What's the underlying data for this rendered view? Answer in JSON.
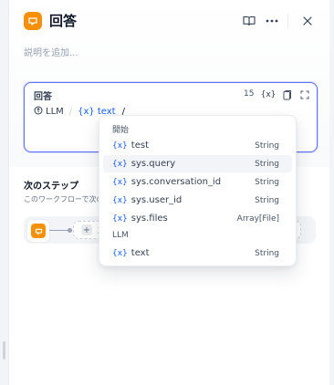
{
  "header": {
    "title": "回答",
    "description_placeholder": "説明を追加...",
    "icon_color": "#f79009"
  },
  "editor": {
    "label": "回答",
    "char_count": "15",
    "var_chip": {
      "node": "LLM",
      "var": "text"
    },
    "typed": "/"
  },
  "next_step": {
    "title": "次のステップ",
    "description": "このワークフローで次のブ",
    "add_label": "次の"
  },
  "dropdown": {
    "groups": [
      {
        "name": "開始",
        "items": [
          {
            "name": "test",
            "type": "String"
          },
          {
            "name": "sys.query",
            "type": "String",
            "active": true
          },
          {
            "name": "sys.conversation_id",
            "type": "String"
          },
          {
            "name": "sys.user_id",
            "type": "String"
          },
          {
            "name": "sys.files",
            "type": "Array[File]"
          }
        ]
      },
      {
        "name": "LLM",
        "items": [
          {
            "name": "text",
            "type": "String"
          }
        ]
      }
    ],
    "var_glyph": "{x}"
  },
  "colors": {
    "accent": "#155eef",
    "focus_border": "#6172f3"
  }
}
